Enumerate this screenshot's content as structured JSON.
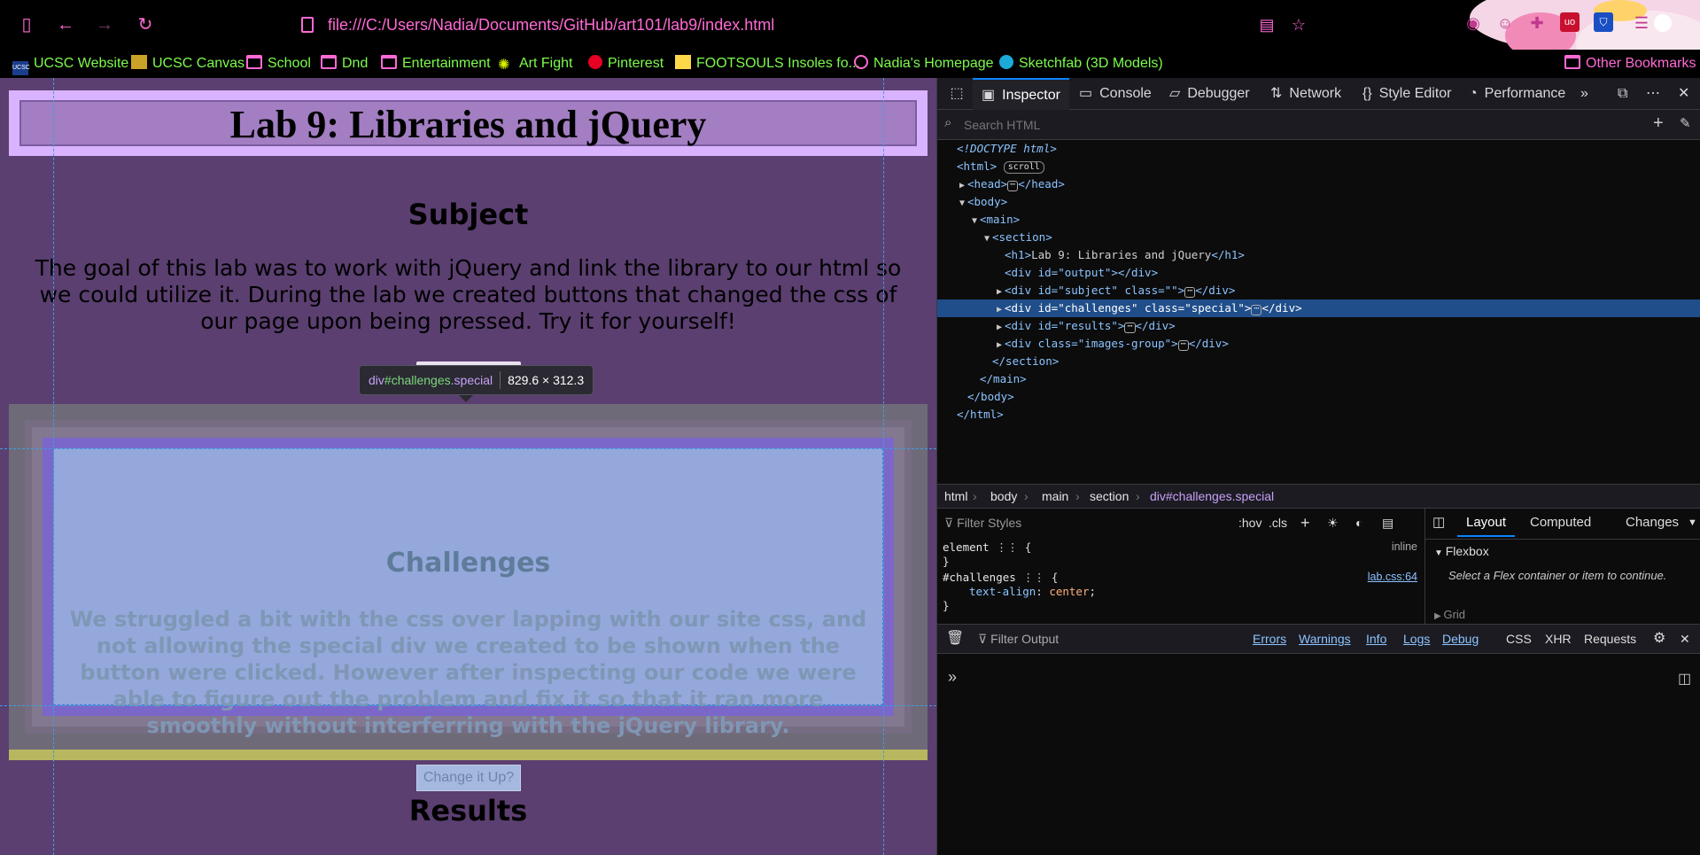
{
  "browser": {
    "url": "file:///C:/Users/Nadia/Documents/GitHub/art101/lab9/index.html",
    "bookmarks": [
      {
        "label": "UCSC Website",
        "icon": "ucsc-favicon"
      },
      {
        "label": "UCSC Canvas",
        "icon": "canvas-favicon"
      },
      {
        "label": "School",
        "icon": "folder-icon"
      },
      {
        "label": "Dnd",
        "icon": "folder-icon"
      },
      {
        "label": "Entertainment",
        "icon": "folder-icon"
      },
      {
        "label": "Art Fight",
        "icon": "artfight-favicon"
      },
      {
        "label": "Pinterest",
        "icon": "pinterest-icon"
      },
      {
        "label": "FOOTSOULS Insoles fo...",
        "icon": "footsouls-favicon"
      },
      {
        "label": "Nadia's Homepage",
        "icon": "globe-icon"
      },
      {
        "label": "Sketchfab (3D Models)",
        "icon": "sketchfab-icon"
      }
    ],
    "other_bookmarks": "Other Bookmarks"
  },
  "page": {
    "title": "Lab 9: Libraries and jQuery",
    "subject_heading": "Subject",
    "subject_text": "The goal of this lab was to work with jQuery and link the library to our html so we could utilize it. During the lab we created buttons that changed the css of our page upon being pressed. Try it for yourself!",
    "challenges_heading": "Challenges",
    "challenges_text": "We struggled a bit with the css over lapping with our site css, and not allowing the special div we created to be shown when the button were clicked. However after inspecting our code we were able to figure out the problem and fix it so that it ran more smoothly without interferring with the jQuery library.",
    "change_button": "Change it Up?",
    "results_heading": "Results"
  },
  "tooltip": {
    "tag": "div",
    "id": "#challenges",
    "cls": ".special",
    "dims": "829.6 × 312.3"
  },
  "devtools": {
    "tabs": [
      "Inspector",
      "Console",
      "Debugger",
      "Network",
      "Style Editor",
      "Performance"
    ],
    "search_placeholder": "Search HTML",
    "markup": {
      "doctype": "<!DOCTYPE html>",
      "html_open": "<html>",
      "scroll_badge": "scroll",
      "head": "<head>",
      "head_close": "</head>",
      "body": "<body>",
      "main": "<main>",
      "section": "<section>",
      "h1_open": "<h1>",
      "h1_text": "Lab 9: Libraries and jQuery",
      "h1_close": "</h1>",
      "div_output": "<div id=\"output\"></div>",
      "div_subject": "<div id=\"subject\" class=\"\">",
      "div_challenges": "<div id=\"challenges\" class=\"special\">",
      "div_results": "<div id=\"results\">",
      "div_images": "<div class=\"images-group\">",
      "div_close": "</div>",
      "section_close": "</section>",
      "main_close": "</main>",
      "body_close": "</body>",
      "html_close": "</html>"
    },
    "breadcrumbs": [
      "html",
      "body",
      "main",
      "section",
      "div#challenges.special"
    ],
    "styles": {
      "filter_placeholder": "Filter Styles",
      "hov": ":hov",
      "cls": ".cls",
      "rule1_selector": "element",
      "rule1_source": "inline",
      "rule2_selector": "#challenges",
      "rule2_source": "lab.css:64",
      "rule2_prop": "text-align",
      "rule2_value": "center"
    },
    "layout_tabs": [
      "Layout",
      "Computed",
      "Changes"
    ],
    "flexbox_title": "Flexbox",
    "flexbox_hint": "Select a Flex container or item to continue.",
    "grid_title": "Grid",
    "console": {
      "filter_placeholder": "Filter Output",
      "filters": [
        "Errors",
        "Warnings",
        "Info",
        "Logs",
        "Debug"
      ],
      "types": [
        "CSS",
        "XHR",
        "Requests"
      ]
    }
  },
  "colors": {
    "accent_pink": "#ff6ad5",
    "bookmark_green": "#7cfc4b",
    "page_bg": "#5b3f70",
    "selection": "#204e8a"
  }
}
